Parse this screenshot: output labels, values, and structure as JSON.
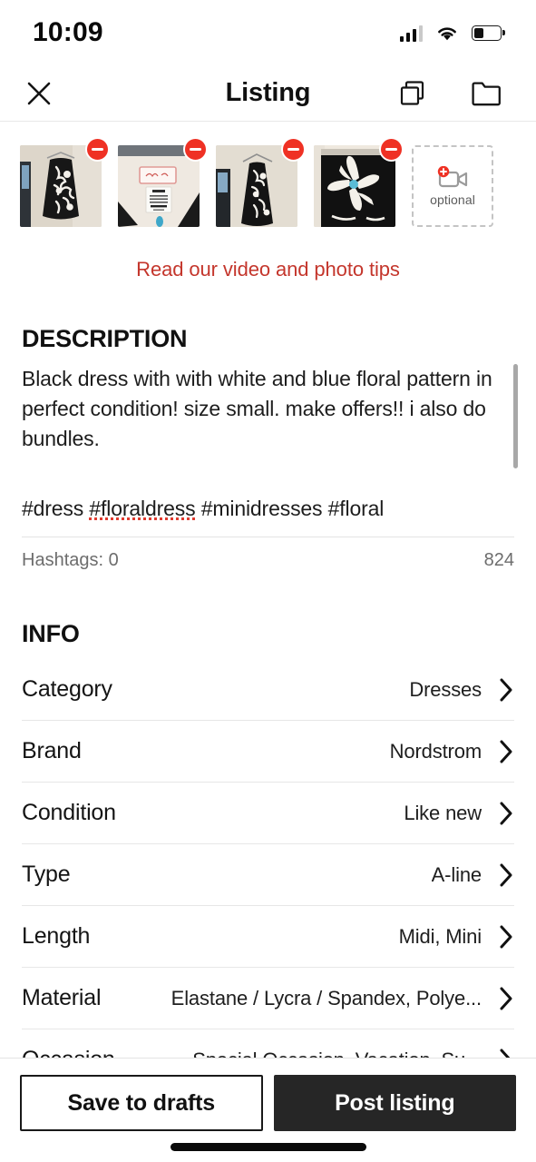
{
  "status_bar": {
    "time": "10:09",
    "signal_icon": "cellular-signal-icon",
    "wifi_icon": "wifi-icon",
    "battery_icon": "battery-icon",
    "battery_level_pct": 38
  },
  "nav": {
    "title": "Listing",
    "close_icon": "close-icon",
    "duplicate_icon": "duplicate-icon",
    "folder_icon": "folder-icon"
  },
  "photos": {
    "items": [
      {
        "alt": "dress-on-hanger-front",
        "remove_icon": "remove-minus-icon"
      },
      {
        "alt": "garment-brand-and-size-label",
        "remove_icon": "remove-minus-icon"
      },
      {
        "alt": "dress-full-length-on-hanger",
        "remove_icon": "remove-minus-icon"
      },
      {
        "alt": "floral-pattern-closeup",
        "remove_icon": "remove-minus-icon"
      }
    ],
    "video_slot": {
      "label": "optional",
      "icon": "add-video-icon"
    },
    "tips_link": "Read our video and photo tips",
    "tips_link_color": "#c4362c",
    "accent_red": "#ef3124"
  },
  "description": {
    "heading": "DESCRIPTION",
    "body": "Black dress with with white and blue floral pattern in perfect condition! size small. make offers!! i also do bundles.",
    "hashtags_line_parts": {
      "before": "#dress ",
      "misspelled": "#floraldress",
      "after": " #minidresses #floral"
    },
    "hashtags_line": "#dress #floraldress #minidresses #floral",
    "hashtag_count_label": "Hashtags: 0",
    "chars_remaining": "824"
  },
  "info": {
    "heading": "INFO",
    "rows": [
      {
        "label": "Category",
        "value": "Dresses"
      },
      {
        "label": "Brand",
        "value": "Nordstrom"
      },
      {
        "label": "Condition",
        "value": "Like new"
      },
      {
        "label": "Type",
        "value": "A-line"
      },
      {
        "label": "Length",
        "value": "Midi, Mini"
      },
      {
        "label": "Material",
        "value": "Elastane / Lycra / Spandex, Polye..."
      },
      {
        "label": "Occasion",
        "value": "Special Occasion, Vacation, Su..."
      }
    ],
    "chevron_icon": "chevron-right-icon"
  },
  "footer": {
    "save_label": "Save to drafts",
    "post_label": "Post listing"
  }
}
